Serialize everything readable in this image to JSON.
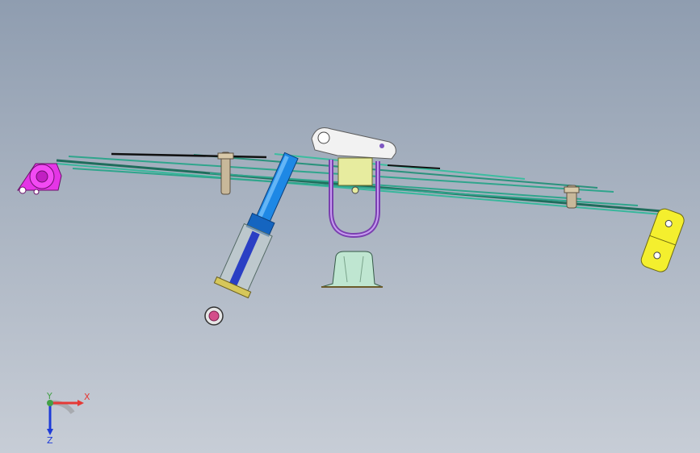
{
  "viewport": {
    "background_top": "#8f9db0",
    "background_bottom": "#c7cdd6"
  },
  "model": {
    "parts": [
      {
        "name": "front-spring-eye-bracket",
        "color": "#e535e6"
      },
      {
        "name": "leaf-spring-pack",
        "color": "#2fa58c"
      },
      {
        "name": "shock-absorber-body",
        "color": "#1e88e5"
      },
      {
        "name": "shock-absorber-guard",
        "color": "#c9d6d3"
      },
      {
        "name": "shock-lower-eye",
        "color": "#d44e8a"
      },
      {
        "name": "u-bolt",
        "color": "#9b59d0"
      },
      {
        "name": "axle-seat-plate",
        "color": "#e7ec9f"
      },
      {
        "name": "upper-bracket",
        "color": "#f2f2f2"
      },
      {
        "name": "bump-stop-bracket",
        "color": "#bfe6d1"
      },
      {
        "name": "rear-shackle",
        "color": "#f4ef2e"
      },
      {
        "name": "leaf-clip",
        "color": "#c8b89a"
      }
    ]
  },
  "triad": {
    "x_label": "X",
    "y_label": "Y",
    "z_label": "Z",
    "x_color": "#e53935",
    "y_color": "#43a047",
    "z_color": "#1e3bd8"
  }
}
